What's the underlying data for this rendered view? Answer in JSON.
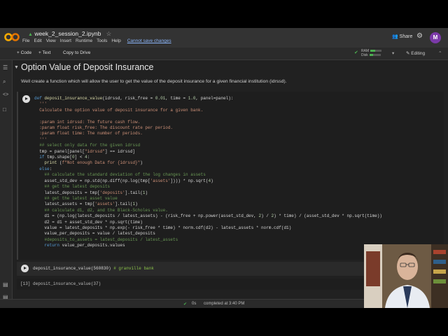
{
  "notebook": {
    "title": "week_2_session_2.ipynb"
  },
  "menu": [
    "File",
    "Edit",
    "View",
    "Insert",
    "Runtime",
    "Tools",
    "Help"
  ],
  "unsaved_note": "Cannot save changes",
  "topright": {
    "share": "Share",
    "avatar": "M"
  },
  "toolbar": {
    "code": "+ Code",
    "text": "+ Text",
    "copy": "Copy to Drive",
    "ram": "RAM",
    "disk": "Disk",
    "editing": "Editing"
  },
  "section": {
    "title": "Option Value of Deposit Insurance",
    "description": "Well create a function which will allow the user to get the value of the deposit insurance for a given financial institution (idrssd)."
  },
  "cell2": {
    "code": "deposit_insurance_value(560830)",
    "comment": "# granville bank"
  },
  "cell3": {
    "prompt": "[13]",
    "code": "deposit_insurance_value(37)"
  },
  "status": {
    "time": "0s",
    "message": "completed at 3:40 PM"
  },
  "colors": {
    "background": "#212121",
    "keyword": "#569cd6",
    "string": "#ce9178",
    "comment": "#6a9955",
    "ok": "#4caf50",
    "avatar": "#7b3aa8"
  },
  "icons": [
    "colab-logo",
    "star-icon",
    "share-icon",
    "gear-icon",
    "menu-icon",
    "search-icon",
    "code-brackets-icon",
    "folder-icon",
    "play-icon",
    "check-icon",
    "pencil-icon"
  ]
}
